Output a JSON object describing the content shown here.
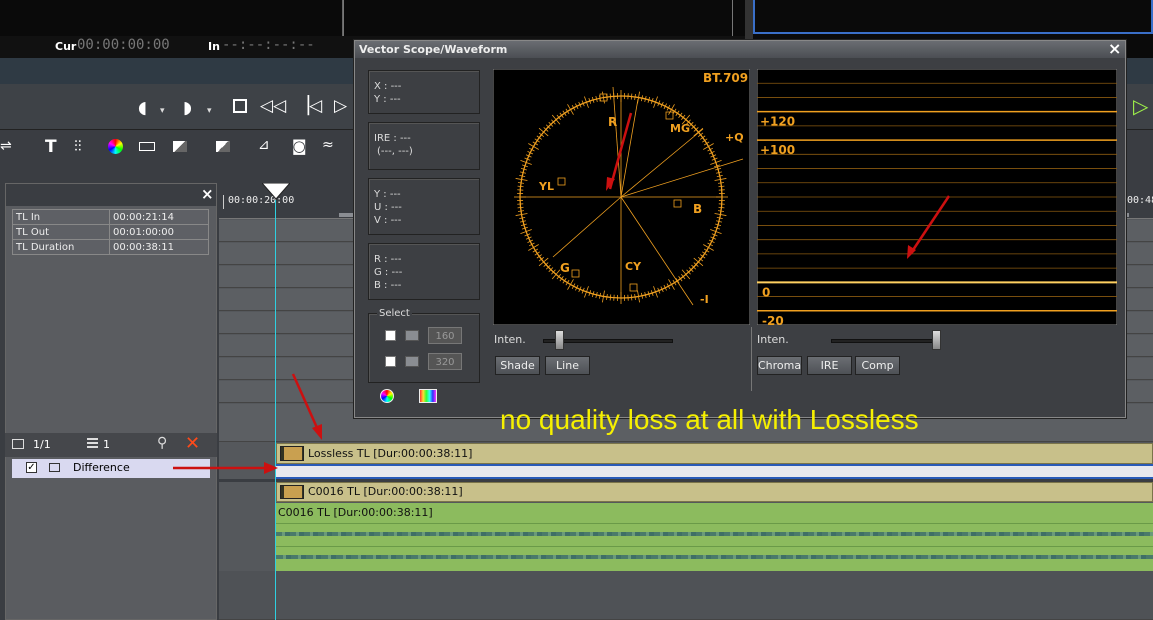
{
  "monitor": {
    "cur_label": "Cur",
    "cur_value": "00:00:00:00",
    "in_label": "In",
    "in_value": "--:--:--:--"
  },
  "clip_info": {
    "rows": [
      {
        "label": "TL In",
        "value": "00:00:21:14"
      },
      {
        "label": "TL Out",
        "value": "00:01:00:00"
      },
      {
        "label": "TL Duration",
        "value": "00:00:38:11"
      }
    ]
  },
  "clip_list": {
    "page": "1/1",
    "count": "1",
    "item_label": "Difference"
  },
  "ruler": {
    "tc_left": "00:00:20:00",
    "tc_right": "00:48"
  },
  "tracks": {
    "lossless_label": "Lossless  TL [Dur:00:00:38:11]",
    "c0016_v_label": "C0016  TL [Dur:00:00:38:11]",
    "c0016_a_label": "C0016  TL [Dur:00:00:38:11]"
  },
  "scope": {
    "title": "Vector Scope/Waveform",
    "close": "×",
    "xy": {
      "x": "X : ---",
      "y": "Y : ---"
    },
    "ire": {
      "line1": "IRE : ---",
      "line2": "(---, ---)"
    },
    "yuv": {
      "y": "Y : ---",
      "u": "U : ---",
      "v": "V : ---"
    },
    "rgb": {
      "r": "R : ---",
      "g": "G : ---",
      "b": "B : ---"
    },
    "select": {
      "label": "Select",
      "v1": "160",
      "v2": "320"
    },
    "vector": {
      "standard": "BT.709",
      "labels": {
        "r": "R",
        "mg": "MG",
        "q": "+Q",
        "yl": "YL",
        "b": "B",
        "g": "G",
        "cy": "CY",
        "i": "-I"
      },
      "inten_label": "Inten.",
      "intensity": 0.12,
      "buttons": {
        "shade": "Shade",
        "line": "Line"
      }
    },
    "waveform": {
      "lines": [
        {
          "label": "+120",
          "value": 120
        },
        {
          "label": "+100",
          "value": 100
        },
        {
          "label": "0",
          "value": 0
        },
        {
          "label": "-20",
          "value": -20
        }
      ],
      "inten_label": "Inten.",
      "intensity": 0.98,
      "buttons": {
        "chroma": "Chroma",
        "ire": "IRE",
        "comp": "Comp"
      }
    }
  },
  "annotation": "no quality loss at all with Lossless",
  "colors": {
    "accent": "#f0a020",
    "annotation": "#f6f000",
    "arrow": "#cc1010"
  }
}
